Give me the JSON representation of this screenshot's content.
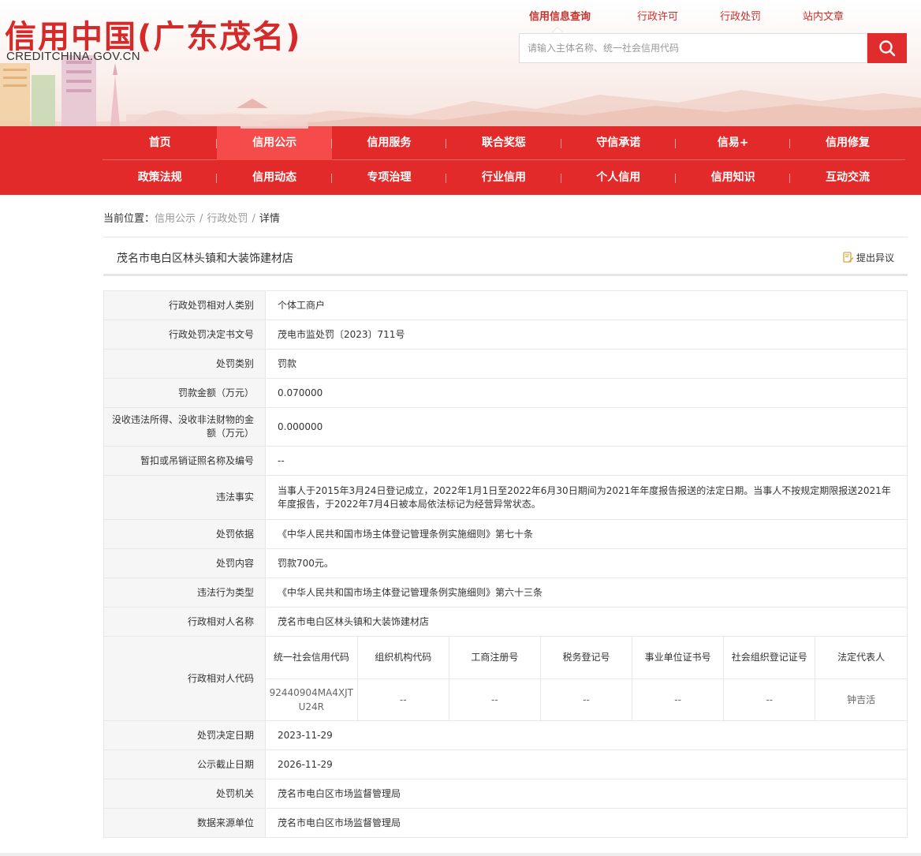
{
  "logo": {
    "cn": "信用中国(广东茂名)",
    "en": "CREDITCHINA.GOV.CN"
  },
  "top_links": [
    "信用信息查询",
    "行政许可",
    "行政处罚",
    "站内文章"
  ],
  "search": {
    "placeholder": "请输入主体名称、统一社会信用代码"
  },
  "nav": {
    "row1": [
      "首页",
      "信用公示",
      "信用服务",
      "联合奖惩",
      "守信承诺",
      "信易+",
      "信用修复"
    ],
    "row2": [
      "政策法规",
      "信用动态",
      "专项治理",
      "行业信用",
      "个人信用",
      "信用知识",
      "互动交流"
    ]
  },
  "breadcrumb": {
    "prefix": "当前位置：",
    "items": [
      "信用公示",
      "行政处罚"
    ],
    "separator": "/",
    "current": "详情"
  },
  "entity": {
    "name": "茂名市电白区林头镇和大装饰建材店",
    "objection_label": "提出异议"
  },
  "details": [
    {
      "label": "行政处罚相对人类别",
      "value": "个体工商户"
    },
    {
      "label": "行政处罚决定书文号",
      "value": "茂电市监处罚〔2023〕711号"
    },
    {
      "label": "处罚类别",
      "value": "罚款"
    },
    {
      "label": "罚款金额（万元）",
      "value": "0.070000"
    },
    {
      "label": "没收违法所得、没收非法财物的金额（万元）",
      "value": "0.000000"
    },
    {
      "label": "暂扣或吊销证照名称及编号",
      "value": "--"
    },
    {
      "label": "违法事实",
      "value": "当事人于2015年3月24日登记成立，2022年1月1日至2022年6月30日期间为2021年年度报告报送的法定日期。当事人不按规定期限报送2021年年度报告，于2022年7月4日被本局依法标记为经营异常状态。"
    },
    {
      "label": "处罚依据",
      "value": "《中华人民共和国市场主体登记管理条例实施细则》第七十条"
    },
    {
      "label": "处罚内容",
      "value": "罚款700元。"
    },
    {
      "label": "违法行为类型",
      "value": "《中华人民共和国市场主体登记管理条例实施细则》第六十三条"
    },
    {
      "label": "行政相对人名称",
      "value": "茂名市电白区林头镇和大装饰建材店"
    }
  ],
  "codes": {
    "label": "行政相对人代码",
    "headers": [
      "统一社会信用代码",
      "组织机构代码",
      "工商注册号",
      "税务登记号",
      "事业单位证书号",
      "社会组织登记证号",
      "法定代表人"
    ],
    "values": [
      "92440904MA4XJTU24R",
      "--",
      "--",
      "--",
      "--",
      "--",
      "钟吉活"
    ]
  },
  "details_after": [
    {
      "label": "处罚决定日期",
      "value": "2023-11-29"
    },
    {
      "label": "公示截止日期",
      "value": "2026-11-29"
    },
    {
      "label": "处罚机关",
      "value": "茂名市电白区市场监督管理局"
    },
    {
      "label": "数据来源单位",
      "value": "茂名市电白区市场监督管理局"
    }
  ],
  "colors": {
    "brand_red": "#e32a2a",
    "link_red": "#c9302c",
    "label_bg": "#f6f6f6",
    "border": "#e8e8e8"
  },
  "icons": {
    "search": "search-icon",
    "objection": "edit-document-icon"
  }
}
